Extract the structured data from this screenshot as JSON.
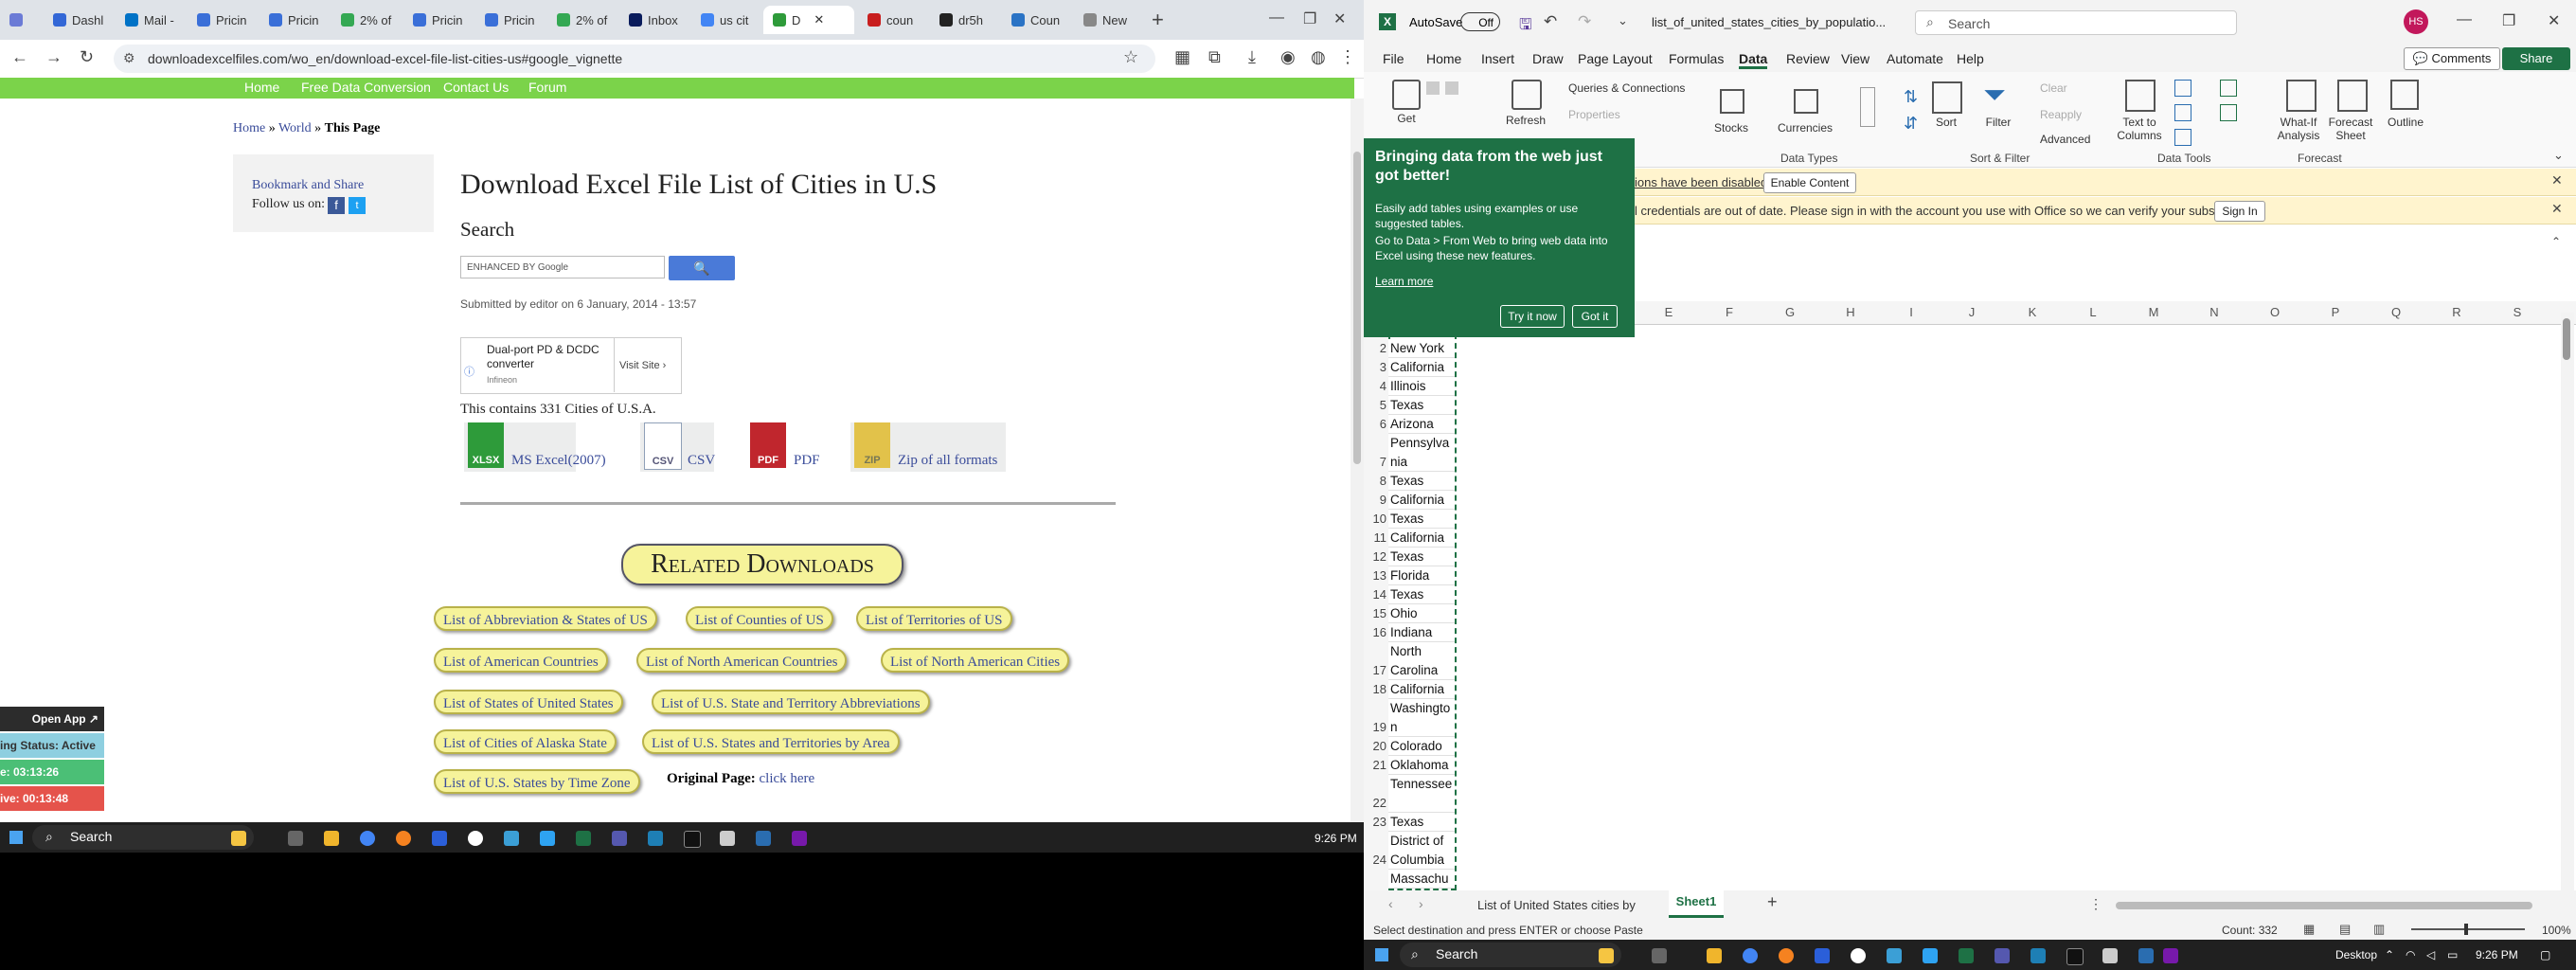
{
  "browser": {
    "tabs": [
      "Dashl",
      "Mail -",
      "Pricin",
      "Pricin",
      "2% of",
      "Pricin",
      "Pricin",
      "2% of",
      "Inbox",
      "us cit",
      "D",
      "coun",
      "dr5h",
      "Coun",
      "New"
    ],
    "url": "downloadexcelfiles.com/wo_en/download-excel-file-list-cities-us#google_vignette",
    "green_nav": [
      "Home",
      "Free Data Conversion",
      "Contact Us",
      "Forum"
    ],
    "breadcrumb": {
      "home": "Home",
      "sep1": "»",
      "world": "World",
      "sep2": "»",
      "current": "This Page"
    },
    "sidebar": {
      "bookmark": "Bookmark and Share",
      "follow": "Follow us on:"
    },
    "page_title": "Download Excel File List of Cities in U.S",
    "search_heading": "Search",
    "search_placeholder": "ENHANCED BY Google",
    "submitted": "Submitted by editor on 6 January, 2014 - 13:57",
    "ad": {
      "title": "Dual-port PD & DCDC converter",
      "company": "Infineon",
      "visit": "Visit Site"
    },
    "contains": "This contains 331 Cities of U.S.A.",
    "downloads": [
      {
        "icon": "XLSX",
        "label": "MS Excel(2007)",
        "color": "#2e9b3a"
      },
      {
        "icon": "CSV",
        "label": "CSV",
        "color": "#8fa0b8"
      },
      {
        "icon": "PDF",
        "label": "PDF",
        "color": "#c0262d"
      },
      {
        "icon": "ZIP",
        "label": "Zip of all formats",
        "color": "#e2c24a"
      }
    ],
    "related_heading": "Related Downloads",
    "related": [
      "List of Abbreviation & States of US",
      "List of Counties of US",
      "List of Territories of US",
      "List of American Countries",
      "List of North American Countries",
      "List of North American Cities",
      "List of States of United States",
      "List of U.S. State and Territory Abbreviations",
      "List of Cities of Alaska State",
      "List of U.S. States and Territories by Area",
      "List of U.S. States by Time Zone"
    ],
    "original_page": {
      "label": "Original Page:",
      "link": "click here"
    },
    "widget": {
      "open_app": "Open App ↗",
      "status": "ing Status: Active",
      "time1": "e: 03:13:26",
      "time2": "ive: 00:13:48"
    }
  },
  "taskbar_left": {
    "search": "Search",
    "time": "9:26 PM"
  },
  "excel": {
    "autosave": "AutoSave",
    "autosave_state": "Off",
    "filename": "list_of_united_states_cities_by_populatio...",
    "search": "Search",
    "user_initials": "HS",
    "menu": [
      "File",
      "Home",
      "Insert",
      "Draw",
      "Page Layout",
      "Formulas",
      "Data",
      "Review",
      "View",
      "Automate",
      "Help"
    ],
    "comments": "Comments",
    "share": "Share",
    "ribbon": {
      "get": "Get",
      "refresh": "Refresh",
      "queries": "Queries & Connections",
      "properties": "Properties",
      "stocks": "Stocks",
      "currencies": "Currencies",
      "sort": "Sort",
      "filter": "Filter",
      "clear": "Clear",
      "reapply": "Reapply",
      "advanced": "Advanced",
      "text_to_columns": "Text to Columns",
      "what_if": "What-If Analysis",
      "forecast_sheet": "Forecast Sheet",
      "outline": "Outline",
      "groups": [
        "Data Types",
        "Sort & Filter",
        "Data Tools",
        "Forecast"
      ]
    },
    "message1": {
      "text": "ions have been disabled",
      "button": "Enable Content"
    },
    "message2": {
      "text": "l credentials are out of date. Please sign in with the account you use with Office so we can verify your subscription.",
      "button": "Sign In"
    },
    "columns": [
      "E",
      "F",
      "G",
      "H",
      "I",
      "J",
      "K",
      "L",
      "M",
      "N",
      "O",
      "P",
      "Q",
      "R",
      "S"
    ],
    "rows": [
      {
        "num": "2",
        "value": "New York"
      },
      {
        "num": "3",
        "value": "California"
      },
      {
        "num": "4",
        "value": "Illinois"
      },
      {
        "num": "5",
        "value": "Texas"
      },
      {
        "num": "6",
        "value": "Arizona"
      },
      {
        "num": "7",
        "value": "Pennsylvania"
      },
      {
        "num": "8",
        "value": "Texas"
      },
      {
        "num": "9",
        "value": "California"
      },
      {
        "num": "10",
        "value": "Texas"
      },
      {
        "num": "11",
        "value": "California"
      },
      {
        "num": "12",
        "value": "Texas"
      },
      {
        "num": "13",
        "value": "Florida"
      },
      {
        "num": "14",
        "value": "Texas"
      },
      {
        "num": "15",
        "value": "Ohio"
      },
      {
        "num": "16",
        "value": "Indiana"
      },
      {
        "num": "17",
        "value": "North Carolina"
      },
      {
        "num": "18",
        "value": "California"
      },
      {
        "num": "19",
        "value": "Washington"
      },
      {
        "num": "20",
        "value": "Colorado"
      },
      {
        "num": "21",
        "value": "Oklahoma"
      },
      {
        "num": "22",
        "value": "Tennessee"
      },
      {
        "num": "23",
        "value": "Texas"
      },
      {
        "num": "24",
        "value": "District of Columbia"
      },
      {
        "num": "",
        "value": "Massachus"
      }
    ],
    "popup": {
      "title": "Bringing data from the web just got better!",
      "body1": "Easily add tables using examples or use suggested tables.",
      "body2": "Go to Data > From Web to bring web data into Excel using these new features.",
      "learn": "Learn more",
      "try": "Try it now",
      "got": "Got it"
    },
    "sheet_tabs": [
      "List of United States cities by",
      "Sheet1"
    ],
    "status_left": "Select destination and press ENTER or choose Paste",
    "count": "Count: 332",
    "zoom": "100%"
  },
  "taskbar_right": {
    "search": "Search",
    "desktop": "Desktop",
    "time": "9:26 PM"
  }
}
